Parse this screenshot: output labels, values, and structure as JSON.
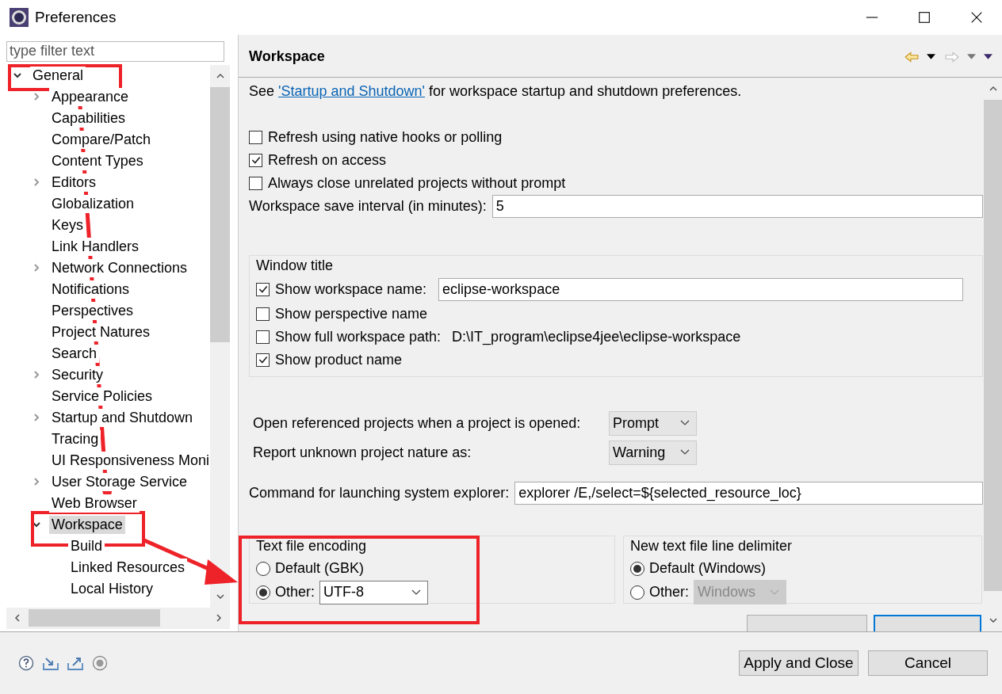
{
  "window": {
    "title": "Preferences"
  },
  "sidebar": {
    "filter": {
      "placeholder": "type filter text"
    },
    "tree": [
      {
        "label": "General",
        "expanded": true,
        "selected": false,
        "children": [
          {
            "label": "Appearance",
            "expanded": false,
            "selected": false
          },
          {
            "label": "Capabilities",
            "selected": false
          },
          {
            "label": "Compare/Patch",
            "selected": false
          },
          {
            "label": "Content Types",
            "selected": false
          },
          {
            "label": "Editors",
            "expanded": false,
            "selected": false
          },
          {
            "label": "Globalization",
            "selected": false
          },
          {
            "label": "Keys",
            "selected": false
          },
          {
            "label": "Link Handlers",
            "selected": false
          },
          {
            "label": "Network Connections",
            "expanded": false,
            "selected": false
          },
          {
            "label": "Notifications",
            "selected": false
          },
          {
            "label": "Perspectives",
            "selected": false
          },
          {
            "label": "Project Natures",
            "selected": false
          },
          {
            "label": "Search",
            "selected": false
          },
          {
            "label": "Security",
            "expanded": false,
            "selected": false
          },
          {
            "label": "Service Policies",
            "selected": false
          },
          {
            "label": "Startup and Shutdown",
            "expanded": false,
            "selected": false
          },
          {
            "label": "Tracing",
            "selected": false
          },
          {
            "label": "UI Responsiveness Moni",
            "selected": false
          },
          {
            "label": "User Storage Service",
            "expanded": false,
            "selected": false
          },
          {
            "label": "Web Browser",
            "selected": false
          },
          {
            "label": "Workspace",
            "expanded": true,
            "selected": true,
            "children": [
              {
                "label": "Build",
                "selected": false
              },
              {
                "label": "Linked Resources",
                "selected": false
              },
              {
                "label": "Local History",
                "selected": false
              }
            ]
          }
        ]
      }
    ]
  },
  "page": {
    "title": "Workspace",
    "intro": {
      "before": "See ",
      "link": "'Startup and Shutdown'",
      "after": " for workspace startup and shutdown preferences."
    },
    "options": [
      {
        "label": "Refresh using native hooks or polling",
        "checked": false
      },
      {
        "label": "Refresh on access",
        "checked": true
      },
      {
        "label": "Always close unrelated projects without prompt",
        "checked": false
      }
    ],
    "save_interval": {
      "label": "Workspace save interval (in minutes):",
      "value": "5"
    },
    "window_title": {
      "legend": "Window title",
      "options": [
        {
          "kind": "field",
          "label": "Show workspace name:",
          "checked": true,
          "value": "eclipse-workspace"
        },
        {
          "kind": "plain",
          "label": "Show perspective name",
          "checked": false
        },
        {
          "kind": "detail",
          "label": "Show full workspace path:",
          "checked": false,
          "detail": "D:\\IT_program\\eclipse4jee\\eclipse-workspace"
        },
        {
          "kind": "plain",
          "label": "Show product name",
          "checked": true
        }
      ]
    },
    "selects": [
      {
        "label": "Open referenced projects when a project is opened:",
        "value": "Prompt"
      },
      {
        "label": "Report unknown project nature as:",
        "value": "Warning"
      }
    ],
    "explorer_command": {
      "label": "Command for launching system explorer:",
      "value": "explorer /E,/select=${selected_resource_loc}"
    },
    "groups": [
      {
        "legend": "Text file encoding",
        "options": [
          {
            "label": "Default (GBK)",
            "selected": false
          },
          {
            "label": "Other:",
            "selected": true,
            "combo": {
              "value": "UTF-8",
              "disabled": false
            }
          }
        ]
      },
      {
        "legend": "New text file line delimiter",
        "options": [
          {
            "label": "Default (Windows)",
            "selected": true
          },
          {
            "label": "Other:",
            "selected": false,
            "combo": {
              "value": "Windows",
              "disabled": true
            }
          }
        ]
      }
    ]
  },
  "buttons": [
    {
      "label": "Apply and Close"
    },
    {
      "label": "Cancel"
    }
  ]
}
